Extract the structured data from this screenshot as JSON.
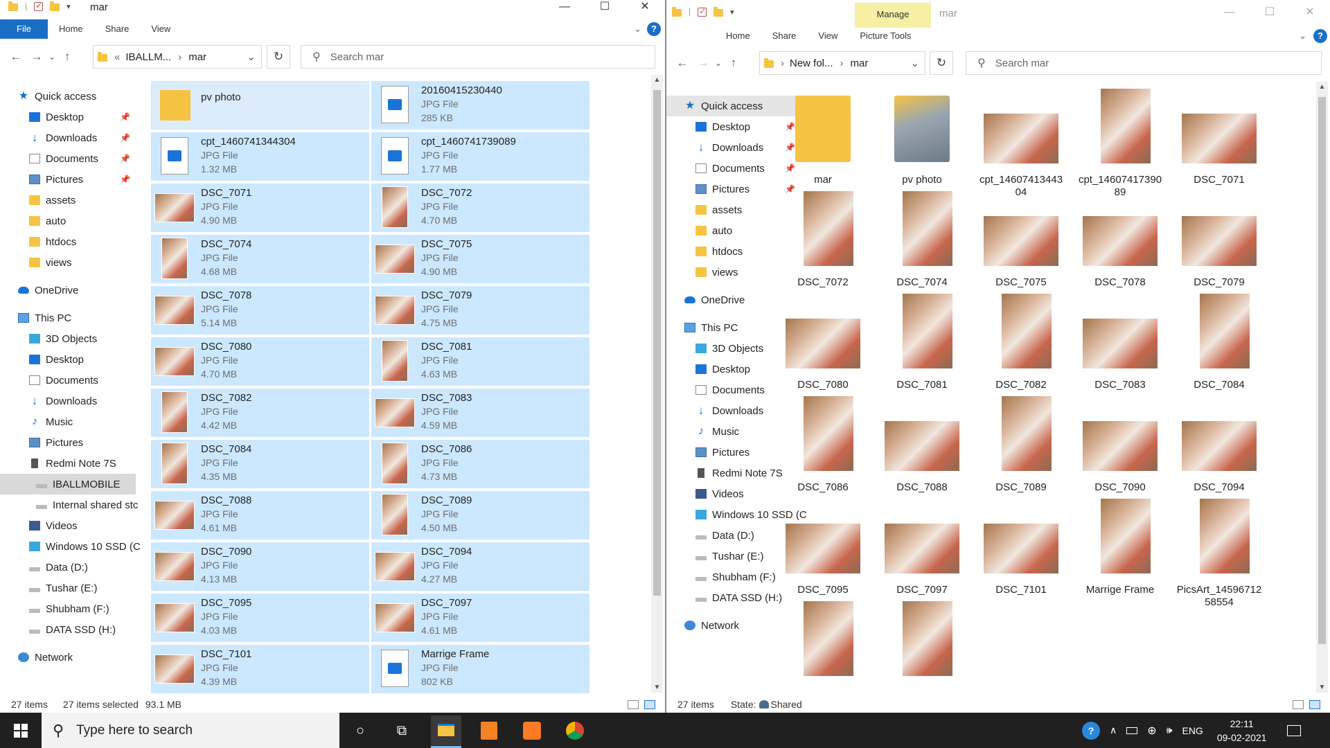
{
  "left": {
    "title": "mar",
    "ribbon": {
      "file": "File",
      "home": "Home",
      "share": "Share",
      "view": "View"
    },
    "nav": {
      "back": "←",
      "forward": "→",
      "recent": "⌄",
      "up": "↑",
      "refresh": "↻",
      "dropdown": "⌄",
      "breadcrumb_more": "«",
      "breadcrumb_sep": "›"
    },
    "address": {
      "part1": "IBALLM...",
      "part2": "mar"
    },
    "search_placeholder": "Search mar",
    "navpane": [
      {
        "label": "Quick access",
        "icon": "star-icon",
        "pin": false
      },
      {
        "label": "Desktop",
        "icon": "desktop-icon",
        "pin": true
      },
      {
        "label": "Downloads",
        "icon": "download-icon",
        "pin": true
      },
      {
        "label": "Documents",
        "icon": "document-icon",
        "pin": true
      },
      {
        "label": "Pictures",
        "icon": "pictures-icon",
        "pin": true
      },
      {
        "label": "assets",
        "icon": "folder-icon",
        "pin": false
      },
      {
        "label": "auto",
        "icon": "folder-icon",
        "pin": false
      },
      {
        "label": "htdocs",
        "icon": "folder-icon",
        "pin": false
      },
      {
        "label": "views",
        "icon": "folder-icon",
        "pin": false
      },
      {
        "label": "OneDrive",
        "icon": "cloud-icon",
        "pin": false
      },
      {
        "label": "This PC",
        "icon": "computer-icon",
        "pin": false
      },
      {
        "label": "3D Objects",
        "icon": "cube-icon",
        "pin": false
      },
      {
        "label": "Desktop",
        "icon": "desktop-icon",
        "pin": false
      },
      {
        "label": "Documents",
        "icon": "document-icon",
        "pin": false
      },
      {
        "label": "Downloads",
        "icon": "download-icon",
        "pin": false
      },
      {
        "label": "Music",
        "icon": "music-icon",
        "pin": false
      },
      {
        "label": "Pictures",
        "icon": "pictures-icon",
        "pin": false
      },
      {
        "label": "Redmi Note 7S",
        "icon": "phone-icon",
        "pin": false
      },
      {
        "label": "IBALLMOBILE",
        "icon": "drive-icon",
        "pin": false
      },
      {
        "label": "Internal shared stc",
        "icon": "drive-icon",
        "pin": false
      },
      {
        "label": "Videos",
        "icon": "video-icon",
        "pin": false
      },
      {
        "label": "Windows 10 SSD (C",
        "icon": "windows-drive-icon",
        "pin": false
      },
      {
        "label": "Data (D:)",
        "icon": "drive-icon",
        "pin": false
      },
      {
        "label": "Tushar (E:)",
        "icon": "drive-icon",
        "pin": false
      },
      {
        "label": "Shubham (F:)",
        "icon": "drive-icon",
        "pin": false
      },
      {
        "label": "DATA SSD (H:)",
        "icon": "drive-icon",
        "pin": false
      },
      {
        "label": "Network",
        "icon": "network-icon",
        "pin": false
      }
    ],
    "files": [
      {
        "name": "pv photo",
        "type": "",
        "size": "",
        "kind": "folder"
      },
      {
        "name": "20160415230440",
        "type": "JPG File",
        "size": "285 KB",
        "kind": "jpgicon"
      },
      {
        "name": "cpt_1460741344304",
        "type": "JPG File",
        "size": "1.32 MB",
        "kind": "jpgicon"
      },
      {
        "name": "cpt_1460741739089",
        "type": "JPG File",
        "size": "1.77 MB",
        "kind": "jpgicon"
      },
      {
        "name": "DSC_7071",
        "type": "JPG File",
        "size": "4.90 MB",
        "kind": "h"
      },
      {
        "name": "DSC_7072",
        "type": "JPG File",
        "size": "4.70 MB",
        "kind": "v"
      },
      {
        "name": "DSC_7074",
        "type": "JPG File",
        "size": "4.68 MB",
        "kind": "v"
      },
      {
        "name": "DSC_7075",
        "type": "JPG File",
        "size": "4.90 MB",
        "kind": "h"
      },
      {
        "name": "DSC_7078",
        "type": "JPG File",
        "size": "5.14 MB",
        "kind": "h"
      },
      {
        "name": "DSC_7079",
        "type": "JPG File",
        "size": "4.75 MB",
        "kind": "h"
      },
      {
        "name": "DSC_7080",
        "type": "JPG File",
        "size": "4.70 MB",
        "kind": "h"
      },
      {
        "name": "DSC_7081",
        "type": "JPG File",
        "size": "4.63 MB",
        "kind": "v"
      },
      {
        "name": "DSC_7082",
        "type": "JPG File",
        "size": "4.42 MB",
        "kind": "v"
      },
      {
        "name": "DSC_7083",
        "type": "JPG File",
        "size": "4.59 MB",
        "kind": "h"
      },
      {
        "name": "DSC_7084",
        "type": "JPG File",
        "size": "4.35 MB",
        "kind": "v"
      },
      {
        "name": "DSC_7086",
        "type": "JPG File",
        "size": "4.73 MB",
        "kind": "v"
      },
      {
        "name": "DSC_7088",
        "type": "JPG File",
        "size": "4.61 MB",
        "kind": "h"
      },
      {
        "name": "DSC_7089",
        "type": "JPG File",
        "size": "4.50 MB",
        "kind": "v"
      },
      {
        "name": "DSC_7090",
        "type": "JPG File",
        "size": "4.13 MB",
        "kind": "h"
      },
      {
        "name": "DSC_7094",
        "type": "JPG File",
        "size": "4.27 MB",
        "kind": "h"
      },
      {
        "name": "DSC_7095",
        "type": "JPG File",
        "size": "4.03 MB",
        "kind": "h"
      },
      {
        "name": "DSC_7097",
        "type": "JPG File",
        "size": "4.61 MB",
        "kind": "h"
      },
      {
        "name": "DSC_7101",
        "type": "JPG File",
        "size": "4.39 MB",
        "kind": "h"
      },
      {
        "name": "Marrige Frame",
        "type": "JPG File",
        "size": "802 KB",
        "kind": "jpgicon"
      }
    ],
    "status": {
      "items": "27 items",
      "selected": "27 items selected",
      "size": "93.1 MB"
    }
  },
  "right": {
    "title": "mar",
    "manage": "Manage",
    "ribbon": {
      "home": "Home",
      "share": "Share",
      "view": "View",
      "picture_tools": "Picture Tools"
    },
    "nav": {
      "back": "←",
      "forward": "→",
      "recent": "⌄",
      "up": "↑",
      "refresh": "↻",
      "dropdown": "⌄",
      "breadcrumb_sep": "›"
    },
    "address": {
      "part1": "New fol...",
      "part2": "mar"
    },
    "search_placeholder": "Search mar",
    "navpane": [
      {
        "label": "Quick access",
        "icon": "star-icon",
        "pin": false
      },
      {
        "label": "Desktop",
        "icon": "desktop-icon",
        "pin": true
      },
      {
        "label": "Downloads",
        "icon": "download-icon",
        "pin": true
      },
      {
        "label": "Documents",
        "icon": "document-icon",
        "pin": true
      },
      {
        "label": "Pictures",
        "icon": "pictures-icon",
        "pin": true
      },
      {
        "label": "assets",
        "icon": "folder-icon",
        "pin": false
      },
      {
        "label": "auto",
        "icon": "folder-icon",
        "pin": false
      },
      {
        "label": "htdocs",
        "icon": "folder-icon",
        "pin": false
      },
      {
        "label": "views",
        "icon": "folder-icon",
        "pin": false
      },
      {
        "label": "OneDrive",
        "icon": "cloud-icon",
        "pin": false
      },
      {
        "label": "This PC",
        "icon": "computer-icon",
        "pin": false
      },
      {
        "label": "3D Objects",
        "icon": "cube-icon",
        "pin": false
      },
      {
        "label": "Desktop",
        "icon": "desktop-icon",
        "pin": false
      },
      {
        "label": "Documents",
        "icon": "document-icon",
        "pin": false
      },
      {
        "label": "Downloads",
        "icon": "download-icon",
        "pin": false
      },
      {
        "label": "Music",
        "icon": "music-icon",
        "pin": false
      },
      {
        "label": "Pictures",
        "icon": "pictures-icon",
        "pin": false
      },
      {
        "label": "Redmi Note 7S",
        "icon": "phone-icon",
        "pin": false
      },
      {
        "label": "Videos",
        "icon": "video-icon",
        "pin": false
      },
      {
        "label": "Windows 10 SSD (C",
        "icon": "windows-drive-icon",
        "pin": false
      },
      {
        "label": "Data (D:)",
        "icon": "drive-icon",
        "pin": false
      },
      {
        "label": "Tushar (E:)",
        "icon": "drive-icon",
        "pin": false
      },
      {
        "label": "Shubham (F:)",
        "icon": "drive-icon",
        "pin": false
      },
      {
        "label": "DATA SSD (H:)",
        "icon": "drive-icon",
        "pin": false
      },
      {
        "label": "Network",
        "icon": "network-icon",
        "pin": false
      }
    ],
    "files": [
      {
        "name": "mar",
        "kind": "folder"
      },
      {
        "name": "pv photo",
        "kind": "folderphoto"
      },
      {
        "name": "cpt_14607413443\n04",
        "kind": "h"
      },
      {
        "name": "cpt_14607417390\n89",
        "kind": "v"
      },
      {
        "name": "DSC_7071",
        "kind": "h"
      },
      {
        "name": "DSC_7072",
        "kind": "v"
      },
      {
        "name": "DSC_7074",
        "kind": "v"
      },
      {
        "name": "DSC_7075",
        "kind": "h"
      },
      {
        "name": "DSC_7078",
        "kind": "h"
      },
      {
        "name": "DSC_7079",
        "kind": "h"
      },
      {
        "name": "DSC_7080",
        "kind": "h"
      },
      {
        "name": "DSC_7081",
        "kind": "v"
      },
      {
        "name": "DSC_7082",
        "kind": "v"
      },
      {
        "name": "DSC_7083",
        "kind": "h"
      },
      {
        "name": "DSC_7084",
        "kind": "v"
      },
      {
        "name": "DSC_7086",
        "kind": "v"
      },
      {
        "name": "DSC_7088",
        "kind": "h"
      },
      {
        "name": "DSC_7089",
        "kind": "v"
      },
      {
        "name": "DSC_7090",
        "kind": "h"
      },
      {
        "name": "DSC_7094",
        "kind": "h"
      },
      {
        "name": "DSC_7095",
        "kind": "h"
      },
      {
        "name": "DSC_7097",
        "kind": "h"
      },
      {
        "name": "DSC_7101",
        "kind": "h"
      },
      {
        "name": "Marrige Frame",
        "kind": "v"
      },
      {
        "name": "PicsArt_14596712\n58554",
        "kind": "v"
      },
      {
        "name": "",
        "kind": "v"
      },
      {
        "name": "",
        "kind": "v"
      }
    ],
    "status": {
      "items": "27 items",
      "state": "State:",
      "shared": "Shared"
    }
  },
  "taskbar": {
    "search_placeholder": "Type here to search",
    "lang": "ENG",
    "time": "22:11",
    "date": "09-02-2021"
  },
  "colors": {
    "accent": "#1a6fc4",
    "selection": "#cce8ff",
    "manage": "#f7efa4",
    "taskbar": "#202020"
  }
}
